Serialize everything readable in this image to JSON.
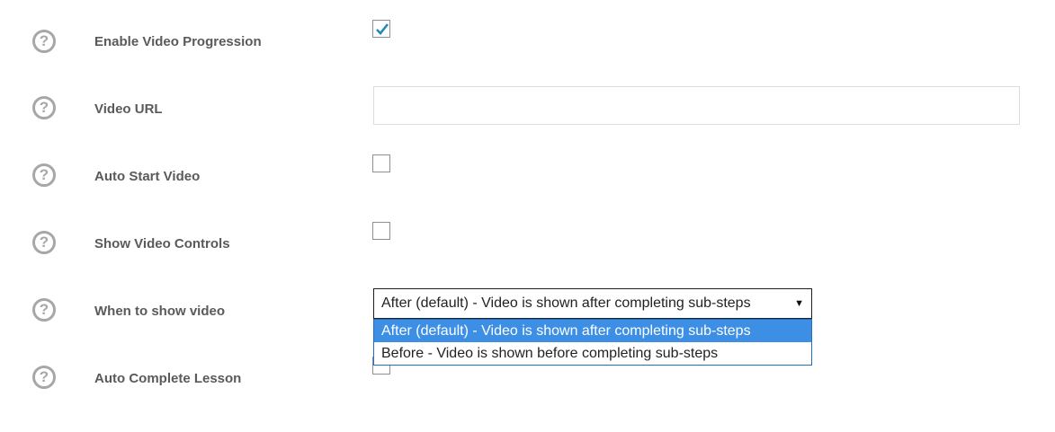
{
  "settings": [
    {
      "label": "Enable Video Progression",
      "help_icon": "help-icon",
      "control": "checkbox",
      "checked": true
    },
    {
      "label": "Video URL",
      "help_icon": "help-icon",
      "control": "text",
      "value": ""
    },
    {
      "label": "Auto Start Video",
      "help_icon": "help-icon",
      "control": "checkbox",
      "checked": false
    },
    {
      "label": "Show Video Controls",
      "help_icon": "help-icon",
      "control": "checkbox",
      "checked": false
    },
    {
      "label": "When to show video",
      "help_icon": "help-icon",
      "control": "select",
      "value": "After (default) - Video is shown after completing sub-steps"
    },
    {
      "label": "Auto Complete Lesson",
      "help_icon": "help-icon",
      "control": "checkbox",
      "checked": false
    }
  ],
  "help_glyph": "?",
  "select_arrow": "▼",
  "dropdown": {
    "open": true,
    "options": [
      {
        "label": "After (default) - Video is shown after completing sub-steps",
        "selected": true
      },
      {
        "label": "Before - Video is shown before completing sub-steps",
        "selected": false
      }
    ]
  },
  "colors": {
    "checkmark": "#1e8cbe",
    "selected_option": "#3d8fe6",
    "help_icon": "#a7a7a7",
    "label_text": "#5a5a5a"
  }
}
